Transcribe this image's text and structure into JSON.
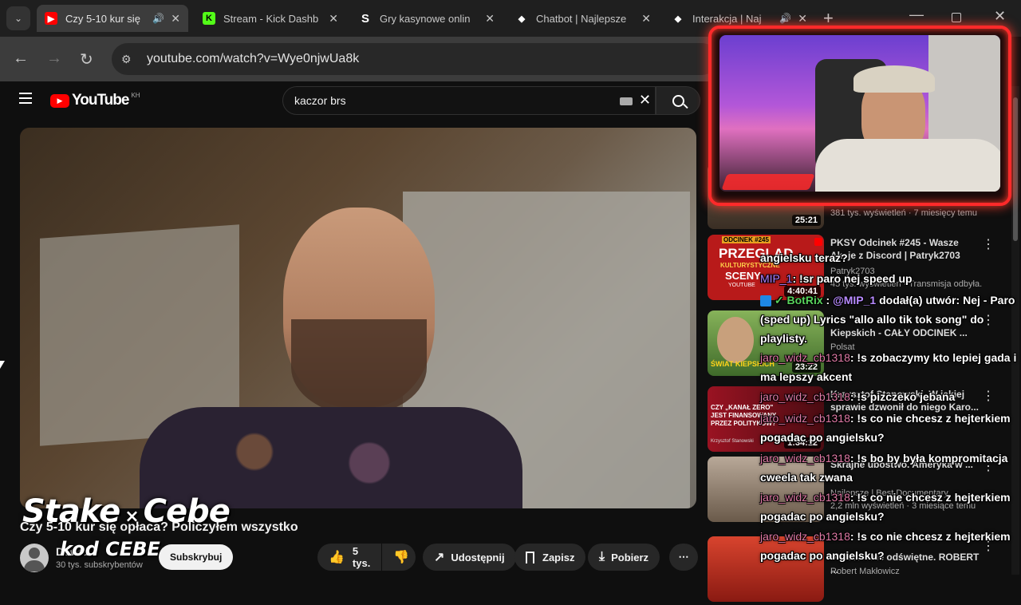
{
  "browser": {
    "tabs": [
      {
        "title": "Czy 5-10 kur się",
        "fav_color": "#ff0000",
        "active": true
      },
      {
        "title": "Stream - Kick Dashb",
        "fav_color": "#53fc18"
      },
      {
        "title": "Gry kasynowe onlin",
        "fav_color": "#1f1f1f"
      },
      {
        "title": "Chatbot | Najlepsze",
        "fav_color": "#1f1f1f"
      },
      {
        "title": "Interakcja | Naj",
        "fav_color": "#1f1f1f"
      }
    ],
    "url": "youtube.com/watch?v=Wye0njwUa8k"
  },
  "youtube": {
    "logo": "YouTube",
    "region": "KH",
    "search_value": "kaczor brs",
    "video_title": "Czy 5-10 kur się opłaca? Policzyłem wszystko",
    "channel_name": "Dawid",
    "subscribers": "30 tys. subskrybentów",
    "subscribe_label": "Subskrybuj",
    "likes": "5 tys.",
    "share_label": "Udostępnij",
    "save_label": "Zapisz",
    "download_label": "Pobierz"
  },
  "recommendations": [
    {
      "title": "",
      "meta1": "381 tys. wyświetleń · 7 miesięcy temu",
      "meta2": "",
      "duration": "25:21",
      "thumb_color": "#5a4a3a"
    },
    {
      "title": "PKSY Odcinek #245 - Wasze Akcje z Discord | Patryk2703",
      "meta1": "Patryk2703",
      "meta2": "45 tys. wyświetleń · Transmisja odbyła...",
      "duration": "4:40:41",
      "thumb_color": "#b81a1a",
      "thumb_text1": "ODCINEK #245",
      "thumb_text2": "PRZEGLĄD",
      "thumb_text3": "KULTURYSTYCZNE",
      "thumb_text4": "SCENY",
      "thumb_text5": "YOUTUBE"
    },
    {
      "title": "Kiepskich - CAŁY ODCINEK ...",
      "meta1": "Polsat",
      "meta2": "",
      "duration": "23:22",
      "thumb_color": "#4b7a2a",
      "thumb_text1": "ŚWIAT KIEPSKICH"
    },
    {
      "title": "Krzysztof Stanowski. W jakiej sprawie dzwonił do niego Karo...",
      "meta1": "",
      "meta2": "",
      "duration": "1:34:12",
      "thumb_color": "#8a1520",
      "thumb_text1": "CZY „KANAŁ ZERO\" JEST FINANSOWANY PRZEZ POLITYKÓW?",
      "thumb_text2": "Krzysztof Stanowski"
    },
    {
      "title": "Skrajne ubóstwo. Ameryka w ...",
      "meta1": "Najlepsze | Best Documentary",
      "meta2": "2,2 mln wyświetleń · 3 miesiące temu",
      "duration": "",
      "thumb_color": "#9a8a7a"
    },
    {
      "title": "\"Gotowanie odświętne. ROBERT ...",
      "meta1": "Robert Makłowicz",
      "meta2": "",
      "duration": "",
      "thumb_color": "#c23a2a"
    }
  ],
  "chat": [
    {
      "user": "",
      "text": "angielsku teraz?"
    },
    {
      "user": "MIP_1",
      "text": ": !sr paro nej speed up"
    },
    {
      "user": "BotRix",
      "mention": "@MIP_1",
      "text": " dodał(a) utwór: Nej - Paro (sped up) Lyrics \"allo allo tik tok song\" do playlisty."
    },
    {
      "user": "jaro_widz_cb1318",
      "text": ": !s zobaczymy kto lepiej gada i ma lepszy akcent"
    },
    {
      "user": "jaro_widz_cb1318",
      "text": ": !s pizczeko jebana"
    },
    {
      "user": "jaro_widz_cb1318",
      "text": ": !s co nie chcesz z hejterkiem pogadac po angielsku?"
    },
    {
      "user": "jaro_widz_cb1318",
      "text": ": !s bo by była kompromitacja cweela tak zwana"
    },
    {
      "user": "jaro_widz_cb1318",
      "text": ": !s co nie chcesz z hejterkiem pogadac po angielsku?"
    },
    {
      "user": "jaro_widz_cb1318",
      "text": ": !s co nie chcesz z hejterkiem pogadac po angielsku?"
    }
  ],
  "watermark": {
    "line1": "Stake",
    "x": "×",
    "line1b": "Cebe",
    "line2": "kod CEBE"
  },
  "colors": {
    "yt_red": "#ff0000",
    "kick_green": "#53fc18",
    "cam_frame": "#ff2a2a"
  }
}
